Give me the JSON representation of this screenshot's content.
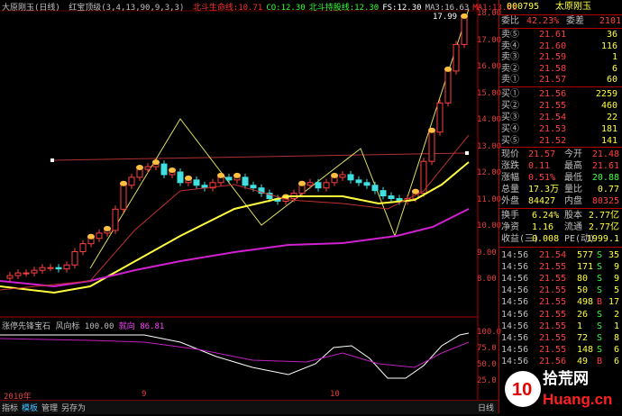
{
  "header": {
    "title": "大原刚玉(日线)",
    "indicator": "红宝顶级(3,4,13,90,9,3,3)",
    "items": [
      {
        "label": "北斗生命线:10.71",
        "color": "#ff3030"
      },
      {
        "label": "CO:12.30",
        "color": "#30ff30"
      },
      {
        "label": "北斗持股线:12.30",
        "color": "#30ff30"
      },
      {
        "label": "FS:12.30",
        "color": "#ffffff"
      },
      {
        "label": "MA3:16.63",
        "color": "#c0c0c0"
      },
      {
        "label": "MA1:13.61",
        "color": "#ff3030"
      }
    ]
  },
  "price_axis": [
    "18.00",
    "17.00",
    "16.00",
    "15.00",
    "14.00",
    "13.00",
    "12.00",
    "11.00",
    "10.00",
    "9.00",
    "8.00"
  ],
  "price_marker": "17.99",
  "sub_header": {
    "name": "涨停先锋宝石",
    "param": "风向标 100.00",
    "value": "就向 86.81"
  },
  "sub_axis": [
    "100.0",
    "75.0",
    "50.0",
    "25.0"
  ],
  "x_labels": [
    "2010年",
    "9",
    "10"
  ],
  "bottom_tabs": [
    "指标",
    "模板",
    "管理",
    "另存为"
  ],
  "bottom_right": "日线",
  "quote": {
    "code": "000795",
    "name": "太原刚玉",
    "ratio_label": "委比",
    "ratio": "42.23%",
    "diff_label": "委差",
    "diff": "2101",
    "asks": [
      {
        "label": "卖⑤",
        "price": "21.61",
        "vol": "36"
      },
      {
        "label": "卖④",
        "price": "21.60",
        "vol": "116"
      },
      {
        "label": "卖③",
        "price": "21.59",
        "vol": "1"
      },
      {
        "label": "卖②",
        "price": "21.58",
        "vol": "6"
      },
      {
        "label": "卖①",
        "price": "21.57",
        "vol": "60"
      }
    ],
    "bids": [
      {
        "label": "买①",
        "price": "21.56",
        "vol": "2259"
      },
      {
        "label": "买②",
        "price": "21.55",
        "vol": "460"
      },
      {
        "label": "买③",
        "price": "21.54",
        "vol": "22"
      },
      {
        "label": "买④",
        "price": "21.53",
        "vol": "181"
      },
      {
        "label": "买⑤",
        "price": "21.52",
        "vol": "141"
      }
    ],
    "stats": [
      {
        "l1": "现价",
        "v1": "21.57",
        "l2": "今开",
        "v2": "21.48"
      },
      {
        "l1": "涨跌",
        "v1": "0.11",
        "l2": "最高",
        "v2": "21.61"
      },
      {
        "l1": "涨幅",
        "v1": "0.51%",
        "l2": "最低",
        "v2": "20.88"
      },
      {
        "l1": "总量",
        "v1": "17.3万",
        "l2": "量比",
        "v2": "0.77"
      },
      {
        "l1": "外盘",
        "v1": "84427",
        "l2": "内盘",
        "v2": "80325"
      }
    ],
    "stats2": [
      {
        "l1": "换手",
        "v1": "6.24%",
        "l2": "股本",
        "v2": "2.77亿"
      },
      {
        "l1": "净资",
        "v1": "1.16",
        "l2": "流通",
        "v2": "2.77亿"
      },
      {
        "l1": "收益(三)",
        "v1": "0.008",
        "l2": "PE(动)",
        "v2": "1999.1"
      }
    ],
    "ticks": [
      {
        "t": "14:56",
        "p": "21.54",
        "v": "577",
        "s": "S",
        "c": "35"
      },
      {
        "t": "14:56",
        "p": "21.55",
        "v": "171",
        "s": "S",
        "c": "9"
      },
      {
        "t": "14:56",
        "p": "21.55",
        "v": "80",
        "s": "S",
        "c": "9"
      },
      {
        "t": "14:56",
        "p": "21.55",
        "v": "50",
        "s": "S",
        "c": "5"
      },
      {
        "t": "14:56",
        "p": "21.55",
        "v": "498",
        "s": "B",
        "c": "17"
      },
      {
        "t": "14:56",
        "p": "21.55",
        "v": "26",
        "s": "S",
        "c": "2"
      },
      {
        "t": "14:56",
        "p": "21.55",
        "v": "1",
        "s": "S",
        "c": "1"
      },
      {
        "t": "14:56",
        "p": "21.55",
        "v": "72",
        "s": "S",
        "c": "8"
      },
      {
        "t": "14:56",
        "p": "21.55",
        "v": "148",
        "s": "S",
        "c": "6"
      },
      {
        "t": "14:56",
        "p": "21.56",
        "v": "49",
        "s": "B",
        "c": "6"
      }
    ]
  },
  "watermark": {
    "brand": "10",
    "site": "Huang.cn",
    "cn": "拾荒网"
  }
}
